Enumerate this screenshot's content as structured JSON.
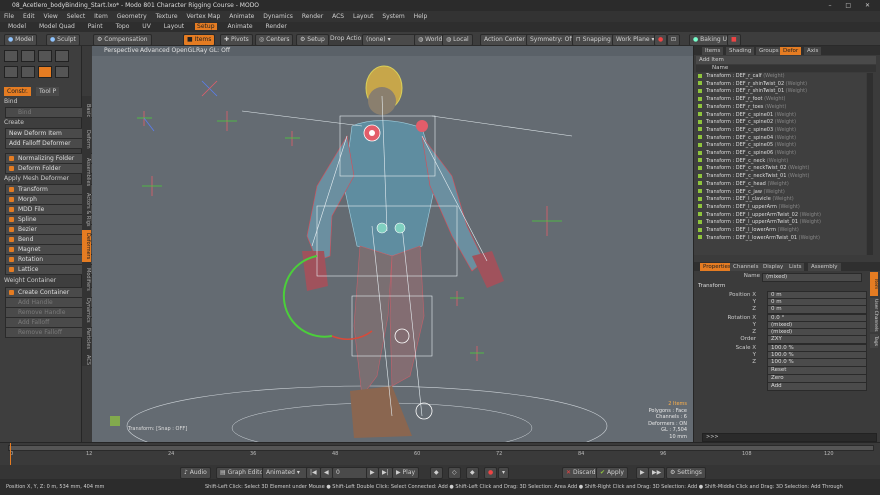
{
  "window": {
    "title": "08_Acetlero_bodyBinding_Start.lxo* - Modo 801 Character Rigging Course - MODO",
    "controls": [
      "–",
      "□",
      "✕"
    ]
  },
  "menu": [
    "File",
    "Edit",
    "View",
    "Select",
    "Item",
    "Geometry",
    "Texture",
    "Vertex Map",
    "Animate",
    "Dynamics",
    "Render",
    "ACS",
    "Layout",
    "System",
    "Help"
  ],
  "layouts": [
    "Model",
    "Model Quad",
    "Paint",
    "Topo",
    "UV",
    "Layout",
    "Setup",
    "Animate",
    "Render"
  ],
  "active_layout": "Setup",
  "toolbar": {
    "model": "Model",
    "sculpt": "Sculpt",
    "compensation": "Compensation",
    "items": "Items",
    "pivots": "Pivots",
    "centers": "Centers",
    "setup": "Setup",
    "drop_action": "Drop Action",
    "drop_value": "(none)",
    "world": "World",
    "local": "Local",
    "action_center": "Action Center",
    "symmetry": "Symmetry: Off",
    "snapping": "Snapping",
    "work_plane": "Work Plane",
    "baking": "Baking UI"
  },
  "left_tabs": [
    "Constr.",
    "Tool P"
  ],
  "left_sections": {
    "bind": "Bind",
    "bind_button": "Bind",
    "create": "Create",
    "new_deform": "New Deform Item",
    "add_falloff": "Add Falloff Deformer",
    "normalizing": "Normalizing Folder",
    "deform_folder": "Deform Folder",
    "apply_mesh": "Apply Mesh Deformer",
    "deformers": [
      "Transform",
      "Morph",
      "MDD File",
      "Spline",
      "Bezier",
      "Bend",
      "Magnet",
      "Rotation",
      "Lattice"
    ],
    "weight_container": "Weight Container",
    "weight_buttons": [
      "Create Container",
      "Add Handle",
      "Remove Handle",
      "Add Falloff",
      "Remove Falloff"
    ]
  },
  "vertical_tabs": [
    "Basic",
    "Deform",
    "Assemblies",
    "Actors & Rigs",
    "Deformers",
    "Modifiers",
    "Dynamics",
    "Particles",
    "ACS"
  ],
  "viewport": {
    "view": "Perspective",
    "shading": "Advanced OpenGL",
    "raygl": "Ray GL: Off",
    "snap_info": "Transform: [Snap : OFF]",
    "info_orange": "2 Items",
    "info": [
      "Polygons : Face",
      "Channels : 6",
      "Deformers : ON",
      "GL : 7,504",
      "10 mm"
    ]
  },
  "right_panel": {
    "tabs_top": [
      "Items",
      "Shading",
      "Groups",
      "Defor",
      "Axis"
    ],
    "active_top": "Defor",
    "add_item": "Add Item",
    "col_name": "Name",
    "items": [
      {
        "name": "Transform : DEF_r_calf",
        "tag": "(Weight)"
      },
      {
        "name": "Transform : DEF_r_shinTwist_02",
        "tag": "(Weight)"
      },
      {
        "name": "Transform : DEF_r_shinTwist_01",
        "tag": "(Weight)"
      },
      {
        "name": "Transform : DEF_r_foot",
        "tag": "(Weight)"
      },
      {
        "name": "Transform : DEF_r_toes",
        "tag": "(Weight)"
      },
      {
        "name": "Transform : DEF_c_spine01",
        "tag": "(Weight)"
      },
      {
        "name": "Transform : DEF_c_spine02",
        "tag": "(Weight)"
      },
      {
        "name": "Transform : DEF_c_spine03",
        "tag": "(Weight)"
      },
      {
        "name": "Transform : DEF_c_spine04",
        "tag": "(Weight)"
      },
      {
        "name": "Transform : DEF_c_spine05",
        "tag": "(Weight)"
      },
      {
        "name": "Transform : DEF_c_spine06",
        "tag": "(Weight)"
      },
      {
        "name": "Transform : DEF_c_neck",
        "tag": "(Weight)"
      },
      {
        "name": "Transform : DEF_c_neckTwist_02",
        "tag": "(Weight)"
      },
      {
        "name": "Transform : DEF_c_neckTwist_01",
        "tag": "(Weight)"
      },
      {
        "name": "Transform : DEF_c_head",
        "tag": "(Weight)"
      },
      {
        "name": "Transform : DEF_c_jaw",
        "tag": "(Weight)"
      },
      {
        "name": "Transform : DEF_l_clavicle",
        "tag": "(Weight)"
      },
      {
        "name": "Transform : DEF_l_upperArm",
        "tag": "(Weight)"
      },
      {
        "name": "Transform : DEF_l_upperArmTwist_02",
        "tag": "(Weight)"
      },
      {
        "name": "Transform : DEF_l_upperArmTwist_01",
        "tag": "(Weight)"
      },
      {
        "name": "Transform : DEF_l_lowerArm",
        "tag": "(Weight)"
      },
      {
        "name": "Transform : DEF_l_lowerArmTwist_01",
        "tag": "(Weight)"
      }
    ],
    "tabs_bottom": [
      "Properties",
      "Channels",
      "Display",
      "Lists",
      "Assembly"
    ],
    "active_bottom": "Properties",
    "name_label": "Name",
    "name_value": "(mixed)",
    "section": "Transform",
    "props": [
      {
        "label": "Position X",
        "value": "0 m"
      },
      {
        "label": "Y",
        "value": "0 m"
      },
      {
        "label": "Z",
        "value": "0 m"
      },
      {
        "label": "Rotation X",
        "value": "0.0 °"
      },
      {
        "label": "Y",
        "value": "(mixed)"
      },
      {
        "label": "Z",
        "value": "(mixed)"
      },
      {
        "label": "Order",
        "value": "ZXY"
      },
      {
        "label": "Scale X",
        "value": "100.0 %"
      },
      {
        "label": "Y",
        "value": "100.0 %"
      },
      {
        "label": "Z",
        "value": "100.0 %"
      }
    ],
    "actions": [
      "Reset",
      "Zero",
      "Add"
    ],
    "side_tabs": [
      "Item",
      "User Channels",
      "Tags"
    ],
    "command": ">>>"
  },
  "timeline": {
    "ticks": [
      "0",
      "12",
      "24",
      "36",
      "48",
      "60",
      "72",
      "84",
      "96",
      "108",
      "120"
    ],
    "end": "120"
  },
  "transport": {
    "audio": "Audio",
    "graph_editor": "Graph Editor",
    "animated": "Animated",
    "frame": "0",
    "play": "Play",
    "discard": "Discard",
    "apply": "Apply",
    "settings": "Settings"
  },
  "status": {
    "left": "Position X, Y, Z:   0 m, 534 mm, 404 mm",
    "hints": "Shift-Left Click: Select 3D Element under Mouse  ●  Shift-Left Double Click: Select Connected: Add  ●  Shift-Left Click and Drag: 3D Selection: Area Add  ●  Shift-Right Click and Drag: 3D Selection: Add  ●  Shift-Middle Click and Drag: 3D Selection: Add Through"
  },
  "colors": {
    "accent": "#e57c22",
    "viewport_bg": "#646b72",
    "deformer_green": "#8fc43d"
  }
}
